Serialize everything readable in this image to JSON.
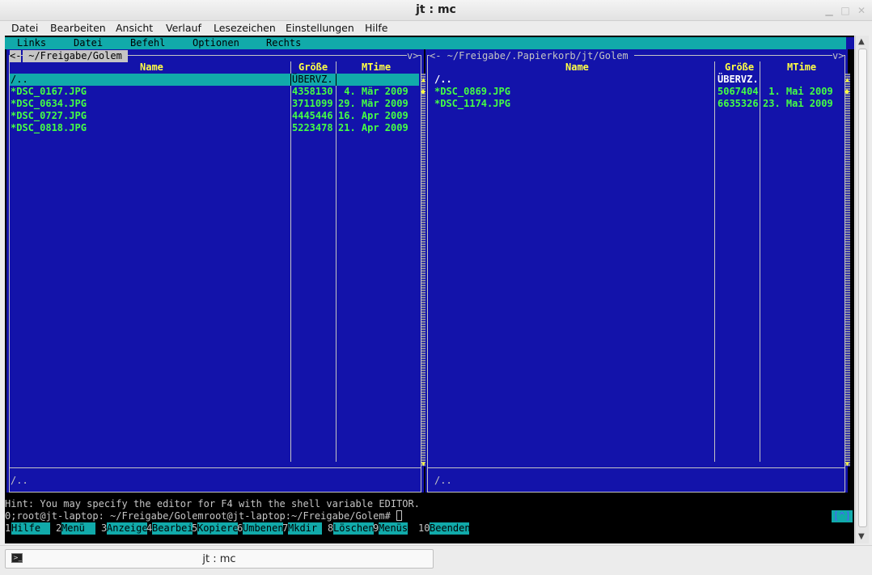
{
  "window": {
    "title": "jt : mc"
  },
  "menubar": [
    "Datei",
    "Bearbeiten",
    "Ansicht",
    "Verlauf",
    "Lesezeichen",
    "Einstellungen",
    "Hilfe"
  ],
  "mc_menu": [
    "Links",
    "Datei",
    "Befehl",
    "Optionen",
    "Rechts"
  ],
  "left_panel": {
    "path": " ~/Freigabe/Golem ",
    "left_marker": "<-",
    "right_marker": "v>",
    "columns": {
      "name": "Name",
      "size": "Größe",
      "mtime": "MTime"
    },
    "rows": [
      {
        "name": "/..",
        "size": "ÜBERVZ.",
        "mtime": "",
        "selected": true
      },
      {
        "name": "*DSC_0167.JPG",
        "size": "4358130",
        "mtime": " 4. Mär 2009"
      },
      {
        "name": "*DSC_0634.JPG",
        "size": "3711099",
        "mtime": "29. Mär 2009"
      },
      {
        "name": "*DSC_0727.JPG",
        "size": "4445446",
        "mtime": "16. Apr 2009"
      },
      {
        "name": "*DSC_0818.JPG",
        "size": "5223478",
        "mtime": "21. Apr 2009"
      }
    ],
    "status": "/.."
  },
  "right_panel": {
    "path": "<- ~/Freigabe/.Papierkorb/jt/Golem ",
    "right_marker": "v>",
    "columns": {
      "name": "Name",
      "size": "Größe",
      "mtime": "MTime"
    },
    "rows": [
      {
        "name": "/..",
        "size": "ÜBERVZ.",
        "mtime": ""
      },
      {
        "name": "*DSC_0869.JPG",
        "size": "5067404",
        "mtime": " 1. Mai 2009"
      },
      {
        "name": "*DSC_1174.JPG",
        "size": "6635326",
        "mtime": "23. Mai 2009"
      }
    ],
    "status": "/.."
  },
  "hint": "Hint: You may specify the editor for F4 with the shell variable EDITOR.",
  "prompt": "0;root@jt-laptop: ~/Freigabe/Golemroot@jt-laptop:~/Freigabe/Golem# ",
  "prompt_right": "[^]",
  "fkeys": [
    {
      "num": "1",
      "label": "Hilfe"
    },
    {
      "num": "2",
      "label": "Menü"
    },
    {
      "num": "3",
      "label": "Anzeige"
    },
    {
      "num": "4",
      "label": "Bearbei"
    },
    {
      "num": "5",
      "label": "Kopiere"
    },
    {
      "num": "6",
      "label": "Umbenen"
    },
    {
      "num": "7",
      "label": "Mkdir"
    },
    {
      "num": "8",
      "label": "Löschen"
    },
    {
      "num": "9",
      "label": "Menüs"
    },
    {
      "num": "10",
      "label": "Beenden"
    }
  ],
  "taskbar": {
    "label": "jt : mc"
  },
  "colors": {
    "panel_bg": "#1313aa",
    "cyan": "#11aaaa",
    "file_green": "#44ff44",
    "header_yellow": "#ffff44"
  }
}
